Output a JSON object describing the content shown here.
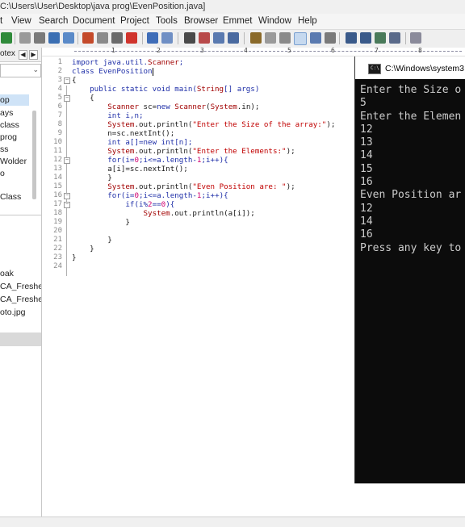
{
  "window": {
    "title": "C:\\Users\\User\\Desktop\\java prog\\EvenPosition.java]"
  },
  "menu": [
    "t",
    "View",
    "Search",
    "Document",
    "Project",
    "Tools",
    "Browser",
    "Emmet",
    "Window",
    "Help"
  ],
  "left_panel": {
    "tab_label": "otex",
    "tree_items": [
      "op",
      "ays",
      "class",
      "prog",
      "ss",
      "Wolder",
      "o",
      "Class"
    ],
    "file_items": [
      "oak",
      "CA_Fresher.c",
      "CA_Fresher.p",
      "oto.jpg"
    ]
  },
  "ruler": {
    "marks": [
      "1",
      "2",
      "3",
      "4",
      "5",
      "6",
      "7",
      "8"
    ]
  },
  "editor": {
    "line_numbers": [
      "1",
      "2",
      "3",
      "4",
      "5",
      "6",
      "7",
      "8",
      "9",
      "10",
      "11",
      "12",
      "13",
      "14",
      "15",
      "16",
      "17",
      "18",
      "19",
      "20",
      "21",
      "22",
      "23",
      "24"
    ],
    "lines": [
      [
        {
          "t": "import java.util.",
          "c": "kw"
        },
        {
          "t": "Scanner",
          "c": "cls"
        },
        {
          "t": ";",
          "c": "kw"
        }
      ],
      [
        {
          "t": "class EvenPosition",
          "c": "kw"
        }
      ],
      [
        {
          "t": "{",
          "c": "plain"
        }
      ],
      [
        {
          "t": "    public static void main(",
          "c": "kw"
        },
        {
          "t": "String",
          "c": "cls"
        },
        {
          "t": "[] args)",
          "c": "kw"
        }
      ],
      [
        {
          "t": "    {",
          "c": "plain"
        }
      ],
      [
        {
          "t": "        ",
          "c": "plain"
        },
        {
          "t": "Scanner",
          "c": "cls"
        },
        {
          "t": " sc=",
          "c": "plain"
        },
        {
          "t": "new ",
          "c": "kw"
        },
        {
          "t": "Scanner",
          "c": "cls"
        },
        {
          "t": "(",
          "c": "plain"
        },
        {
          "t": "System",
          "c": "cls"
        },
        {
          "t": ".in);",
          "c": "plain"
        }
      ],
      [
        {
          "t": "        int i,n;",
          "c": "kw"
        }
      ],
      [
        {
          "t": "        ",
          "c": "plain"
        },
        {
          "t": "System",
          "c": "cls"
        },
        {
          "t": ".out.println(",
          "c": "plain"
        },
        {
          "t": "\"Enter the Size of the array:\"",
          "c": "str"
        },
        {
          "t": ");",
          "c": "plain"
        }
      ],
      [
        {
          "t": "        n=sc.nextInt();",
          "c": "plain"
        }
      ],
      [
        {
          "t": "        int a[]=",
          "c": "kw"
        },
        {
          "t": "new ",
          "c": "kw"
        },
        {
          "t": "int[n];",
          "c": "kw"
        }
      ],
      [
        {
          "t": "        ",
          "c": "plain"
        },
        {
          "t": "System",
          "c": "cls"
        },
        {
          "t": ".out.println(",
          "c": "plain"
        },
        {
          "t": "\"Enter the Elements:\"",
          "c": "str"
        },
        {
          "t": ");",
          "c": "plain"
        }
      ],
      [
        {
          "t": "        for(i=",
          "c": "kw"
        },
        {
          "t": "0",
          "c": "num"
        },
        {
          "t": ";i<=a.length-",
          "c": "kw"
        },
        {
          "t": "1",
          "c": "num"
        },
        {
          "t": ";i++){",
          "c": "kw"
        }
      ],
      [
        {
          "t": "        a[i]=sc.nextInt();",
          "c": "plain"
        }
      ],
      [
        {
          "t": "        }",
          "c": "plain"
        }
      ],
      [
        {
          "t": "        ",
          "c": "plain"
        },
        {
          "t": "System",
          "c": "cls"
        },
        {
          "t": ".out.println(",
          "c": "plain"
        },
        {
          "t": "\"Even Position are: \"",
          "c": "str"
        },
        {
          "t": ");",
          "c": "plain"
        }
      ],
      [
        {
          "t": "        for(i=",
          "c": "kw"
        },
        {
          "t": "0",
          "c": "num"
        },
        {
          "t": ";i<=a.length-",
          "c": "kw"
        },
        {
          "t": "1",
          "c": "num"
        },
        {
          "t": ";i++){",
          "c": "kw"
        }
      ],
      [
        {
          "t": "            if(i%",
          "c": "kw"
        },
        {
          "t": "2",
          "c": "num"
        },
        {
          "t": "==",
          "c": "kw"
        },
        {
          "t": "0",
          "c": "num"
        },
        {
          "t": "){",
          "c": "kw"
        }
      ],
      [
        {
          "t": "                ",
          "c": "plain"
        },
        {
          "t": "System",
          "c": "cls"
        },
        {
          "t": ".out.println(a[i]);",
          "c": "plain"
        }
      ],
      [
        {
          "t": "            }",
          "c": "plain"
        }
      ],
      [
        {
          "t": "",
          "c": "plain"
        }
      ],
      [
        {
          "t": "        }",
          "c": "plain"
        }
      ],
      [
        {
          "t": "    }",
          "c": "plain"
        }
      ],
      [
        {
          "t": "}",
          "c": "plain"
        }
      ],
      [
        {
          "t": "",
          "c": "plain"
        }
      ]
    ]
  },
  "console": {
    "title": "C:\\Windows\\system3",
    "icon_text": "C:\\",
    "lines": [
      "Enter the Size o",
      "5",
      "Enter the Elemen",
      "12",
      "13",
      "14",
      "15",
      "16",
      "Even Position ar",
      "12",
      "14",
      "16",
      "Press any key to"
    ]
  },
  "colors": {
    "keyword": "#1f2fa8",
    "string": "#c00000",
    "class_name": "#a10000",
    "number": "#d00070",
    "console_bg": "#0c0c0c",
    "console_text": "#cccccc"
  }
}
